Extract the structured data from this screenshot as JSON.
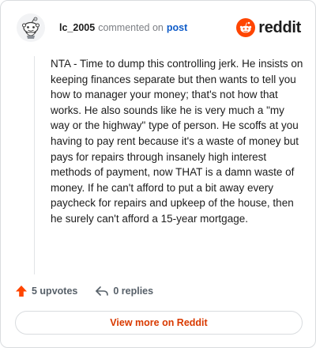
{
  "header": {
    "username": "lc_2005",
    "action_text": "commented on",
    "post_link": "post",
    "brand_name": "reddit",
    "avatar_icon": "reddit-alien-avatar-icon",
    "brand_icon": "reddit-logo-icon"
  },
  "comment": {
    "text": "NTA - Time to dump this controlling jerk. He insists on keeping finances separate but then wants to tell you how to manager your money; that's not how that works. He also sounds like he is very much a \"my way or the highway\" type of person. He scoffs at you having to pay rent because it's a waste of money but pays for repairs through insanely high interest methods of payment, now THAT is a damn waste of money. If he can't afford to put a bit away every paycheck for repairs and upkeep of the house, then he surely can't afford a 15-year mortgage."
  },
  "actions": {
    "upvotes_label": "5 upvotes",
    "replies_label": "0 replies",
    "upvote_icon": "upvote-arrow-icon",
    "reply_icon": "reply-arrow-icon"
  },
  "footer": {
    "view_more_label": "View more on Reddit"
  },
  "colors": {
    "brand_orange": "#ff4500",
    "link_blue": "#0f5cc9",
    "cta_text": "#d93a00",
    "muted_text": "#7c7f84",
    "border": "#d9dcdf"
  }
}
